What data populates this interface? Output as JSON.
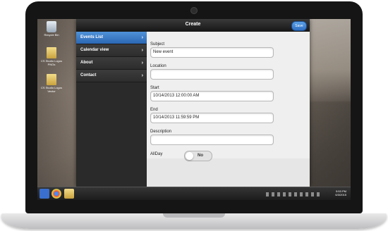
{
  "desktop": {
    "icons": [
      {
        "label": "Recycle Bin",
        "icon": "recycle-bin-icon"
      },
      {
        "label": "CS Studio Logos PNGs",
        "icon": "folder-icon"
      },
      {
        "label": "CS Studio Logos Vector",
        "icon": "folder-icon"
      }
    ],
    "clock": {
      "time": "5:53 PM",
      "date": "6/3/2015"
    }
  },
  "app": {
    "title": "Create",
    "save_label": "Save",
    "menu": [
      {
        "label": "Events List",
        "active": true
      },
      {
        "label": "Calendar view",
        "active": false
      },
      {
        "label": "About",
        "active": false
      },
      {
        "label": "Contact",
        "active": false
      }
    ],
    "form": {
      "subject": {
        "label": "Subject",
        "value": "New event"
      },
      "location": {
        "label": "Location",
        "value": ""
      },
      "start": {
        "label": "Start",
        "value": "10/14/2013 12:00:00 AM"
      },
      "end": {
        "label": "End",
        "value": "10/14/2013 11:59:59 PM"
      },
      "description": {
        "label": "Description",
        "value": ""
      },
      "allday": {
        "label": "AllDay",
        "toggle_text": "No"
      }
    }
  },
  "colors": {
    "accent": "#3a7fd0",
    "header": "#1f1f1f",
    "sidebar": "#2a2a2a"
  }
}
